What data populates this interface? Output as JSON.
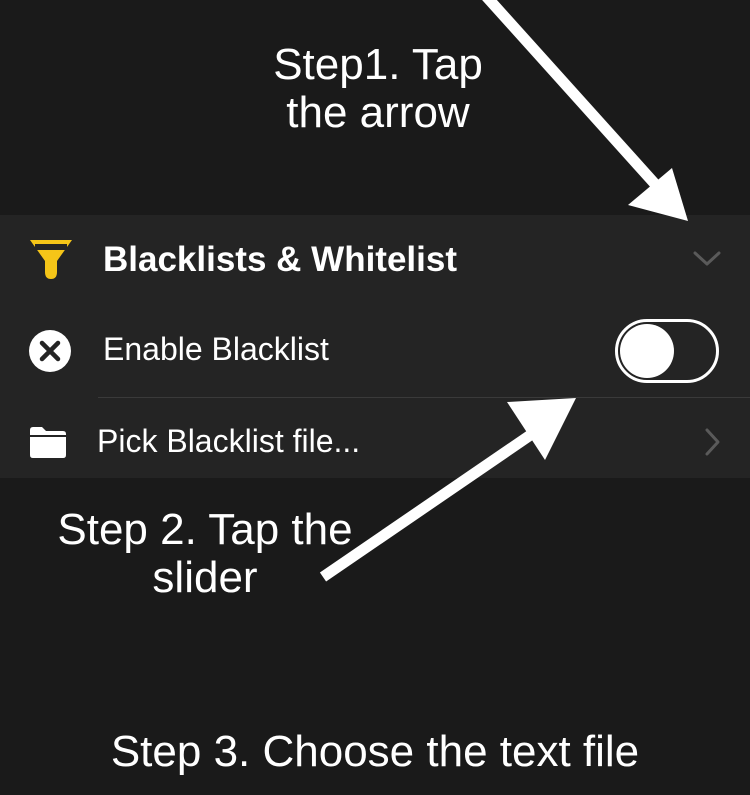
{
  "section": {
    "title": "Blacklists & Whitelist",
    "icon": "funnel-icon",
    "icon_color": "#f5c518",
    "expand_icon": "chevron-down-icon"
  },
  "rows": {
    "enable": {
      "label": "Enable Blacklist",
      "icon": "close-circle-icon",
      "toggle_on": false
    },
    "pick": {
      "label": "Pick Blacklist file...",
      "icon": "folder-icon",
      "disclosure_icon": "chevron-right-icon"
    }
  },
  "annotations": {
    "step1_line1": "Step1. Tap",
    "step1_line2": "the arrow",
    "step2_line1": "Step 2. Tap the",
    "step2_line2": "slider",
    "step3": "Step 3. Choose the text file"
  },
  "colors": {
    "background": "#1a1a1a",
    "panel": "#242424",
    "text": "#ffffff",
    "chevron": "#5a5a5a"
  }
}
